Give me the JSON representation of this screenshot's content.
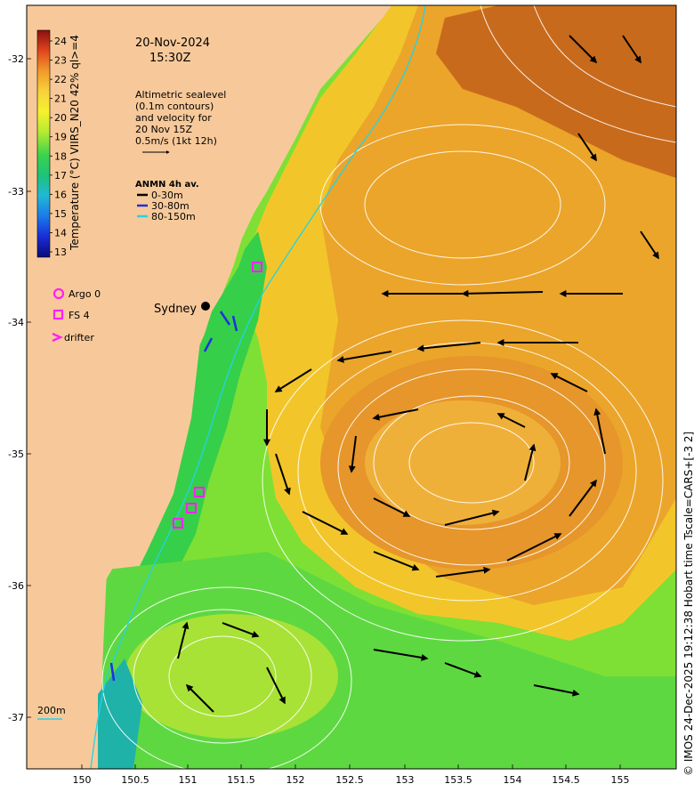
{
  "map": {
    "date": "20-Nov-2024",
    "time": "15:30Z",
    "colorbar": {
      "label": "Temperature (°C) VIIRS_N20 42% ql>=4",
      "ticks": [
        "24",
        "23",
        "22",
        "21",
        "20",
        "19",
        "18",
        "17",
        "16",
        "15",
        "14",
        "13"
      ]
    },
    "altimetry": {
      "lines": [
        "Altimetric sealevel",
        "(0.1m contours)",
        "and velocity for",
        "20 Nov 15Z",
        "0.5m/s (1kt 12h)"
      ]
    },
    "anmn": {
      "title": "ANMN 4h av.",
      "items": [
        {
          "label": "0-30m",
          "color": "#000000"
        },
        {
          "label": "30-80m",
          "color": "#1f2fe0"
        },
        {
          "label": "80-150m",
          "color": "#22d3e6"
        }
      ]
    },
    "legend": {
      "argo": "Argo 0",
      "fs": "FS 4",
      "drifter": "drifter"
    },
    "city": "Sydney",
    "isobath": "200m",
    "lat_ticks": [
      "-32",
      "-33",
      "-34",
      "-35",
      "-36",
      "-37"
    ],
    "lon_ticks": [
      "150",
      "150.5",
      "151",
      "151.5",
      "152",
      "152.5",
      "153",
      "153.5",
      "154",
      "154.5",
      "155"
    ],
    "credit": "© IMOS 24-Dec-2025 19:12:38 Hobart time Tscale=CARS+[-3 2]",
    "colors": {
      "land": "#f7c99a",
      "warm": "#e08a2c",
      "green": "#4cd44a",
      "accent": "#ff22ee"
    }
  }
}
